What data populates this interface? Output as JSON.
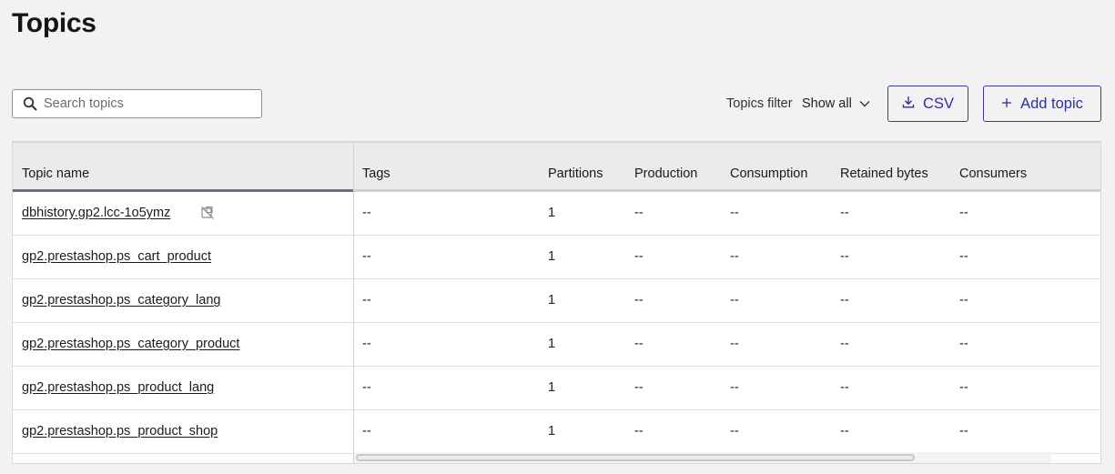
{
  "page": {
    "title": "Topics"
  },
  "search": {
    "placeholder": "Search topics",
    "value": ""
  },
  "filter": {
    "label": "Topics filter",
    "selected": "Show all"
  },
  "buttons": {
    "csv": "CSV",
    "add_topic": "Add topic"
  },
  "table": {
    "headers": {
      "name": "Topic name",
      "tags": "Tags",
      "partitions": "Partitions",
      "production": "Production",
      "consumption": "Consumption",
      "retained": "Retained bytes",
      "consumers": "Consumers"
    },
    "rows": [
      {
        "name": "dbhistory.gp2.lcc-1o5ymz",
        "tags": "--",
        "partitions": "1",
        "production": "--",
        "consumption": "--",
        "retained": "--",
        "consumers": "--",
        "icon": "no-sync-icon"
      },
      {
        "name": "gp2.prestashop.ps_cart_product",
        "tags": "--",
        "partitions": "1",
        "production": "--",
        "consumption": "--",
        "retained": "--",
        "consumers": "--"
      },
      {
        "name": "gp2.prestashop.ps_category_lang",
        "tags": "--",
        "partitions": "1",
        "production": "--",
        "consumption": "--",
        "retained": "--",
        "consumers": "--"
      },
      {
        "name": "gp2.prestashop.ps_category_product",
        "tags": "--",
        "partitions": "1",
        "production": "--",
        "consumption": "--",
        "retained": "--",
        "consumers": "--"
      },
      {
        "name": "gp2.prestashop.ps_product_lang",
        "tags": "--",
        "partitions": "1",
        "production": "--",
        "consumption": "--",
        "retained": "--",
        "consumers": "--"
      },
      {
        "name": "gp2.prestashop.ps_product_shop",
        "tags": "--",
        "partitions": "1",
        "production": "--",
        "consumption": "--",
        "retained": "--",
        "consumers": "--"
      }
    ]
  },
  "colors": {
    "accent": "#2f2fa0",
    "background": "#f2f2f2",
    "header_bg": "#ecebeb"
  }
}
